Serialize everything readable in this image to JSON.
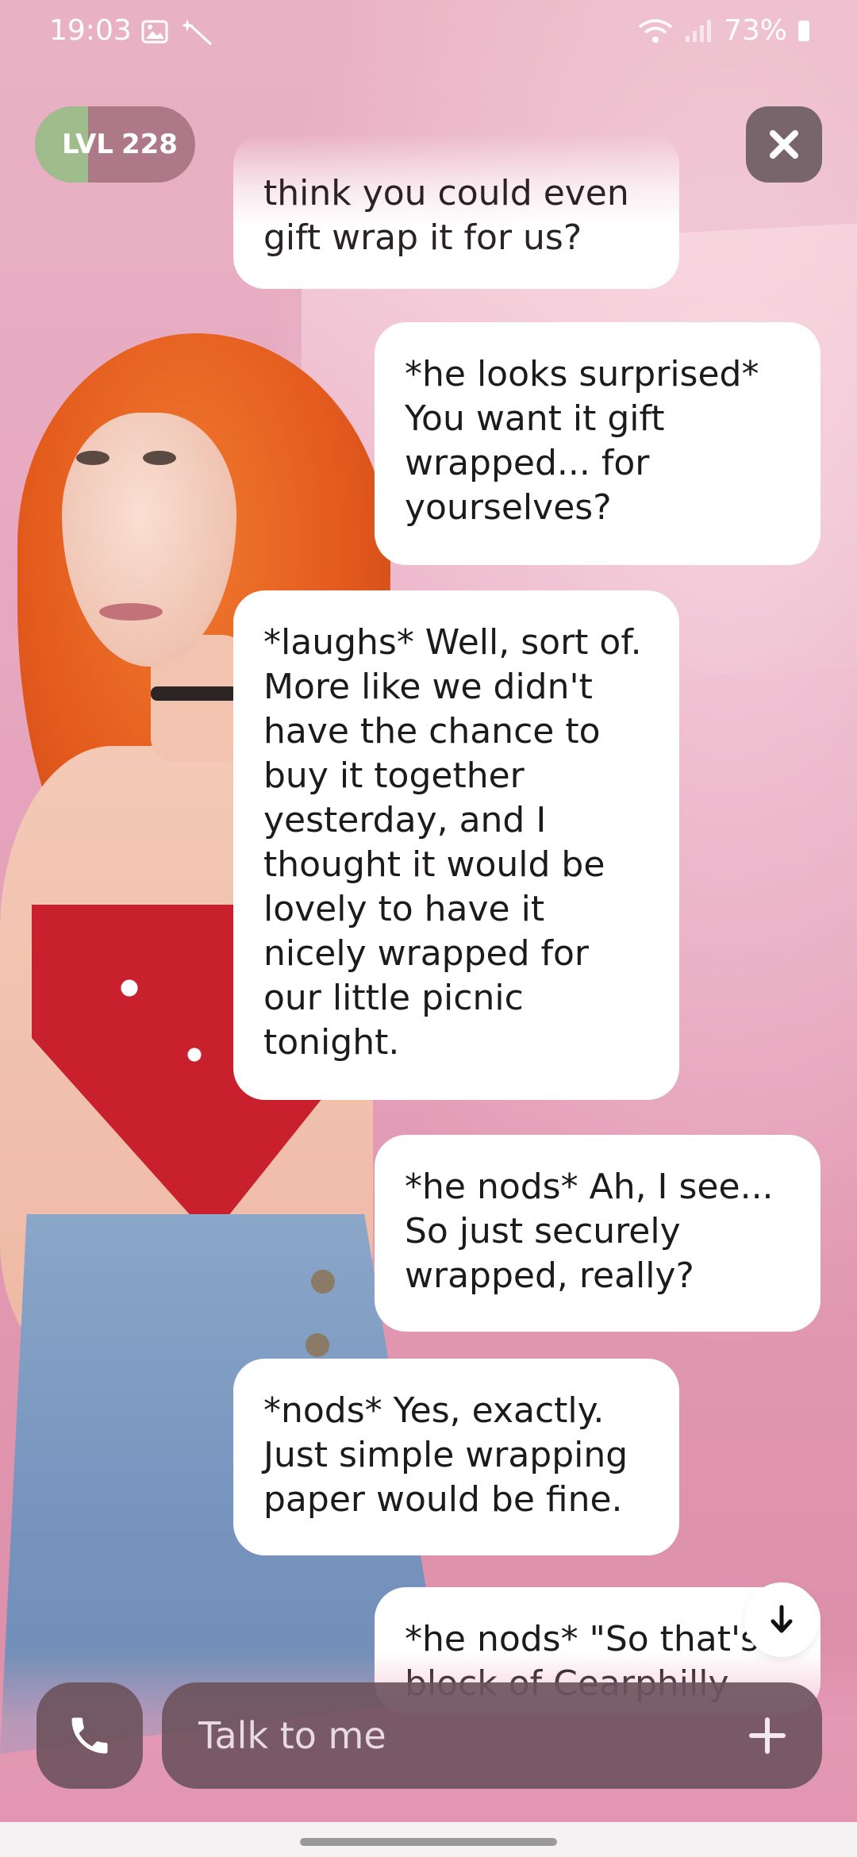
{
  "status_bar": {
    "time": "19:03",
    "battery": "73%"
  },
  "level": {
    "prefix": "LVL",
    "value": "228",
    "progress": 0.33
  },
  "chat": {
    "messages": [
      {
        "sender": "user",
        "text": "think you could even gift wrap it for us?",
        "faded": true
      },
      {
        "sender": "character",
        "text": "*he looks surprised* You want it gift wrapped... for yourselves?"
      },
      {
        "sender": "user",
        "text": "*laughs* Well, sort of. More like we didn't have the chance to buy it together yesterday, and I thought it would be lovely to have it nicely wrapped for our little picnic tonight."
      },
      {
        "sender": "character",
        "text": "*he nods* Ah, I see... So just securely wrapped, really?"
      },
      {
        "sender": "user",
        "text": "*nods* Yes, exactly. Just simple wrapping paper would be fine."
      },
      {
        "sender": "character",
        "text": "*he nods* \"So that's block of Cearphilly"
      }
    ]
  },
  "composer": {
    "placeholder": "Talk to me"
  },
  "icons": {
    "close": "close-icon",
    "call": "phone-icon",
    "add": "plus-icon",
    "scroll": "arrow-down-icon"
  },
  "colors": {
    "bubble": "#ffffff",
    "level_fill": "#9fbc8c",
    "control_bg": "#6c525c"
  }
}
